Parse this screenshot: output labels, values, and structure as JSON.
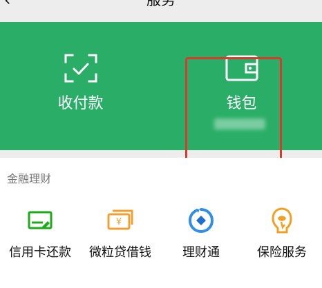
{
  "header": {
    "title": "服务",
    "back_icon": "chevron-left-icon"
  },
  "wallet_panel": {
    "items": [
      {
        "label": "收付款",
        "icon": "scan-check-icon"
      },
      {
        "label": "钱包",
        "icon": "wallet-icon"
      }
    ],
    "highlight_color": "#d93a2b",
    "background_color": "#2aae67"
  },
  "finance": {
    "section_title": "金融理财",
    "items": [
      {
        "label": "信用卡还款",
        "icon": "credit-card-icon",
        "color": "#1aad19"
      },
      {
        "label": "微粒贷借钱",
        "icon": "loan-icon",
        "color": "#f0a030"
      },
      {
        "label": "理财通",
        "icon": "wealth-icon",
        "color": "#2f8ee6"
      },
      {
        "label": "保险服务",
        "icon": "insurance-icon",
        "color": "#f2a024"
      }
    ]
  }
}
